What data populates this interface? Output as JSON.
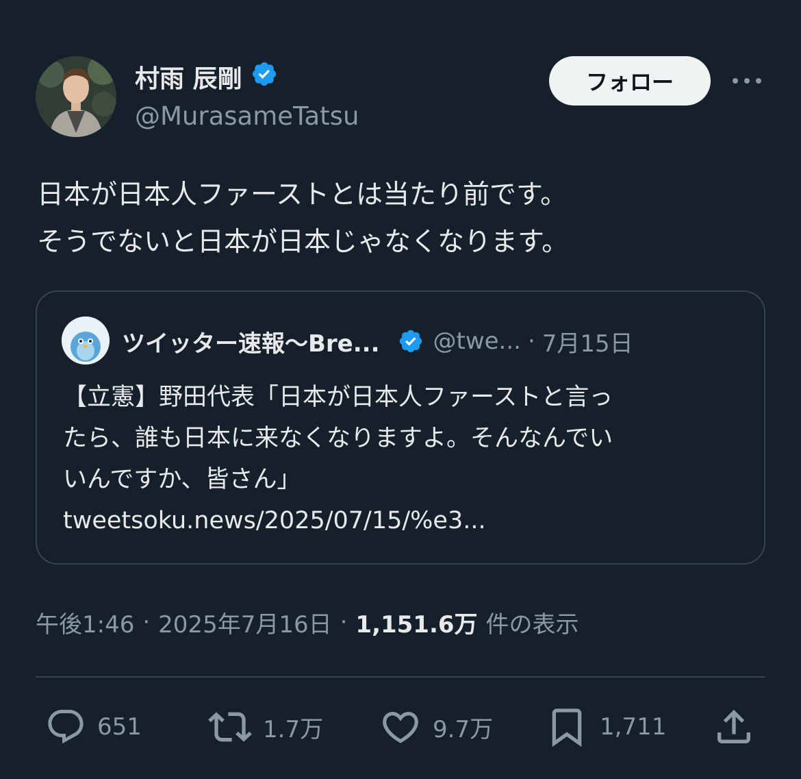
{
  "author": {
    "display_name": "村雨 辰剛",
    "handle": "@MurasameTatsu",
    "verified": true
  },
  "follow_label": "フォロー",
  "more_icon": "more-icon",
  "text_lines": [
    "日本が日本人ファーストとは当たり前です。",
    "そうでないと日本が日本じゃなくなります。"
  ],
  "quote": {
    "name": "ツイッター速報〜Bre...",
    "handle": "@twe...",
    "separator": "·",
    "date": "7月15日",
    "lines": [
      "【立憲】野田代表「日本が日本人ファーストと言っ",
      "たら、誰も日本に来なくなりますよ。そんなんでい",
      "いんですか、皆さん」",
      "tweetsoku.news/2025/07/15/%e3..."
    ]
  },
  "meta": {
    "time": "午後1:46",
    "sep1": "·",
    "date": "2025年7月16日",
    "sep2": "·",
    "views": "1,151.6万",
    "views_label": "件の表示"
  },
  "actions": {
    "replies": "651",
    "reposts": "1.7万",
    "likes": "9.7万",
    "bookmarks": "1,711"
  },
  "colors": {
    "background": "#15202b",
    "verified": "#1d9bf0",
    "secondary_text": "#8b98a5",
    "border": "#38444d"
  }
}
